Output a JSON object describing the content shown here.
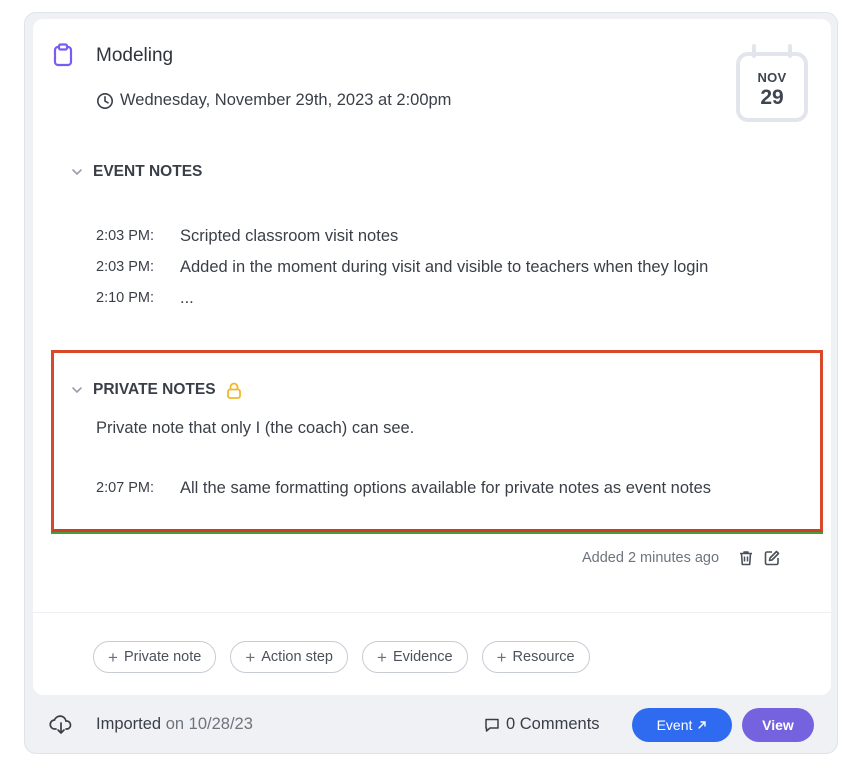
{
  "event": {
    "title": "Modeling",
    "datetime": "Wednesday, November 29th, 2023 at 2:00pm",
    "calendar": {
      "month": "NOV",
      "day": "29"
    },
    "icon": "clipboard-icon"
  },
  "event_notes": {
    "heading": "EVENT NOTES",
    "lines": [
      {
        "time": "2:03 PM:",
        "text": "Scripted classroom visit notes"
      },
      {
        "time": "2:03 PM:",
        "text": "Added in the moment during visit and visible to teachers when they login"
      },
      {
        "time": "2:10 PM:",
        "text": "..."
      }
    ]
  },
  "private_notes": {
    "heading": "PRIVATE NOTES",
    "body": "Private note that only I (the coach) can see.",
    "lines": [
      {
        "time": "2:07 PM:",
        "text": "All the same formatting options available for private notes as event notes"
      }
    ],
    "highlight_color": "#d8482a",
    "lock_color": "#f2b824"
  },
  "meta": {
    "added": "Added 2 minutes ago"
  },
  "chips": [
    {
      "label": "Private note"
    },
    {
      "label": "Action step"
    },
    {
      "label": "Evidence"
    },
    {
      "label": "Resource"
    }
  ],
  "footer": {
    "imported_label": "Imported",
    "imported_date": "on 10/28/23",
    "comments": "0 Comments",
    "event_button": "Event",
    "view_button": "View",
    "event_color": "#2e6bf0",
    "view_color": "#7462de"
  }
}
